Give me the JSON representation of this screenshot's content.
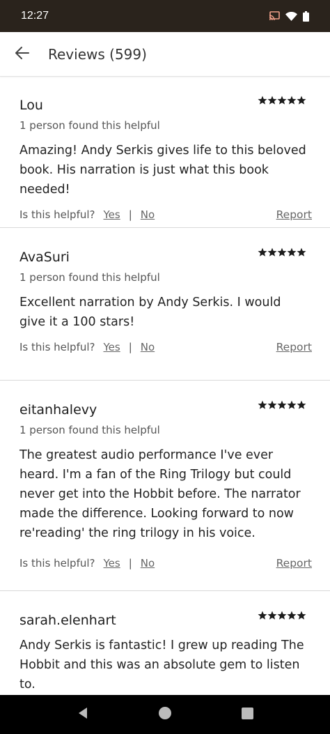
{
  "status_bar": {
    "time": "12:27",
    "icons": [
      "cast-icon",
      "wifi-icon",
      "battery-icon"
    ]
  },
  "header": {
    "title": "Reviews (599)",
    "back_icon": "arrow-left-icon"
  },
  "labels": {
    "helpful_question": "Is this helpful?",
    "yes": "Yes",
    "no": "No",
    "separator": "|",
    "report": "Report"
  },
  "reviews": [
    {
      "name": "Lou",
      "rating": 5,
      "helpful_count": "1 person found this helpful",
      "text": "Amazing! Andy Serkis gives life to this beloved book. His narration is just what this book needed!"
    },
    {
      "name": "AvaSuri",
      "rating": 5,
      "helpful_count": "1 person found this helpful",
      "text": "Excellent narration by Andy Serkis. I would give it a 100 stars!"
    },
    {
      "name": "eitanhalevy",
      "rating": 5,
      "helpful_count": "1 person found this helpful",
      "text": "The greatest audio performance I've ever heard. I'm a fan of the Ring Trilogy but could never get into the Hobbit before. The narrator made the difference. Looking forward to now re'reading' the ring trilogy in his voice."
    },
    {
      "name": "sarah.elenhart",
      "rating": 5,
      "helpful_count": "",
      "text": "Andy Serkis is fantastic! I grew up reading The Hobbit and this was an absolute gem to listen to."
    }
  ],
  "nav_bar": {
    "buttons": [
      "back-triangle-icon",
      "home-circle-icon",
      "recents-square-icon"
    ]
  },
  "colors": {
    "status_bar_bg": "#2a231c",
    "star": "#1d1d1d",
    "divider": "#d8d8d8"
  }
}
